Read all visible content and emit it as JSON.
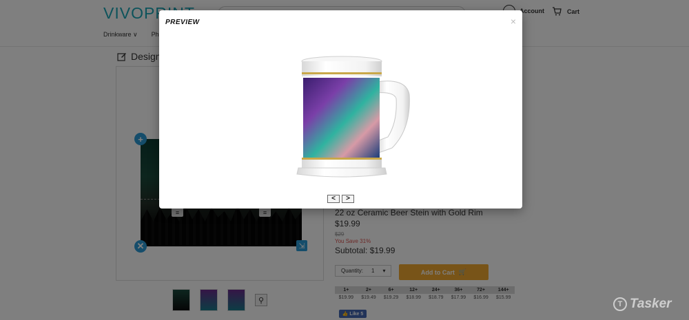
{
  "header": {
    "logo": "VIVOPRINT",
    "account_label": "Account",
    "cart_label": "Cart"
  },
  "nav": {
    "items": [
      "Drinkware ∨",
      "Ph"
    ]
  },
  "designer": {
    "title": "Design"
  },
  "product": {
    "name": "22 oz Ceramic Beer Stein with Gold Rim",
    "price": "$19.99",
    "old_price": "$29",
    "save_text": "You Save 31%",
    "subtotal": "Subtotal: $19.99",
    "quantity_label": "Quantity:",
    "quantity_value": "1",
    "add_to_cart": "Add to Cart"
  },
  "pricing": {
    "headers": [
      "1+",
      "2+",
      "6+",
      "12+",
      "24+",
      "36+",
      "72+",
      "144+"
    ],
    "prices": [
      "$19.99",
      "$19.49",
      "$19.29",
      "$18.99",
      "$18.79",
      "$17.99",
      "$16.99",
      "$15.99"
    ]
  },
  "social": {
    "like_label": "Like 5"
  },
  "modal": {
    "title": "PREVIEW",
    "close": "×",
    "prev": "<",
    "next": ">"
  },
  "watermark": {
    "text": "Tasker"
  },
  "colors": {
    "brand": "#1aa6b7",
    "accent": "#f0a830",
    "control": "#2a9bd6",
    "facebook": "#4267b2"
  }
}
